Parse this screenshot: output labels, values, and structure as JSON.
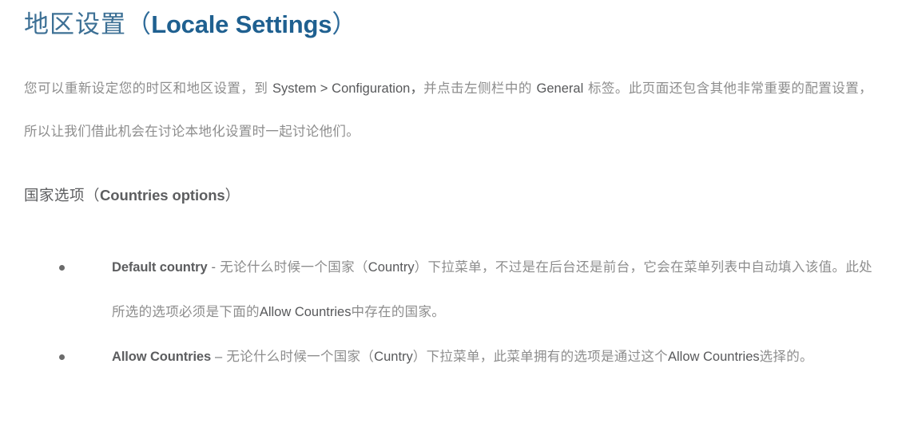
{
  "colors": {
    "title_cn": "#3d7095",
    "title_en": "#1f6090",
    "body_cn": "#8d8d8d",
    "body_latin": "#58595b",
    "heading": "#5d5e60",
    "underline_red": "#e8413f",
    "bullet_marker": "#6b6b6b",
    "background": "#ffffff"
  },
  "title": {
    "cn": "地区设置",
    "paren_open": "（",
    "en": "Locale Settings",
    "paren_close": "）"
  },
  "paragraph": {
    "part1": "您可以重新设定您的时区和地区设置，到 ",
    "underlined": "System > Configuration，",
    "part2": "并点击左侧栏中的 ",
    "latin_general": "General",
    "part3": " 标签。此页面还包含其他非常重要的配置设置，所以让我们借此机会在讨论本地化设置时一起讨论他们。"
  },
  "section_heading": {
    "cn": "国家选项",
    "paren_open": "（",
    "en": "Countries options",
    "paren_close": "）"
  },
  "bullets": [
    {
      "marker": "bullet-dot",
      "term": "Default country",
      "separator": "-",
      "text_part1": "无论什么时候一个国家（",
      "latin_inline1": "Country",
      "text_part2": "）下拉菜单，不过是在后台还是前台，它会在菜单列表中自动填入该值。此处所选的选项必须是下面的",
      "latin_inline2": "Allow Countries",
      "text_part3": "中存在的国家。"
    },
    {
      "marker": "bullet-dot",
      "term": "Allow Countries",
      "separator": "–",
      "text_part1": "无论什么时候一个国家（",
      "latin_inline1": "Cuntry",
      "text_part2": "）下拉菜单，此菜单拥有的选项是通过这个",
      "latin_inline2": "Allow Countries",
      "text_part3": "选择的。"
    }
  ]
}
